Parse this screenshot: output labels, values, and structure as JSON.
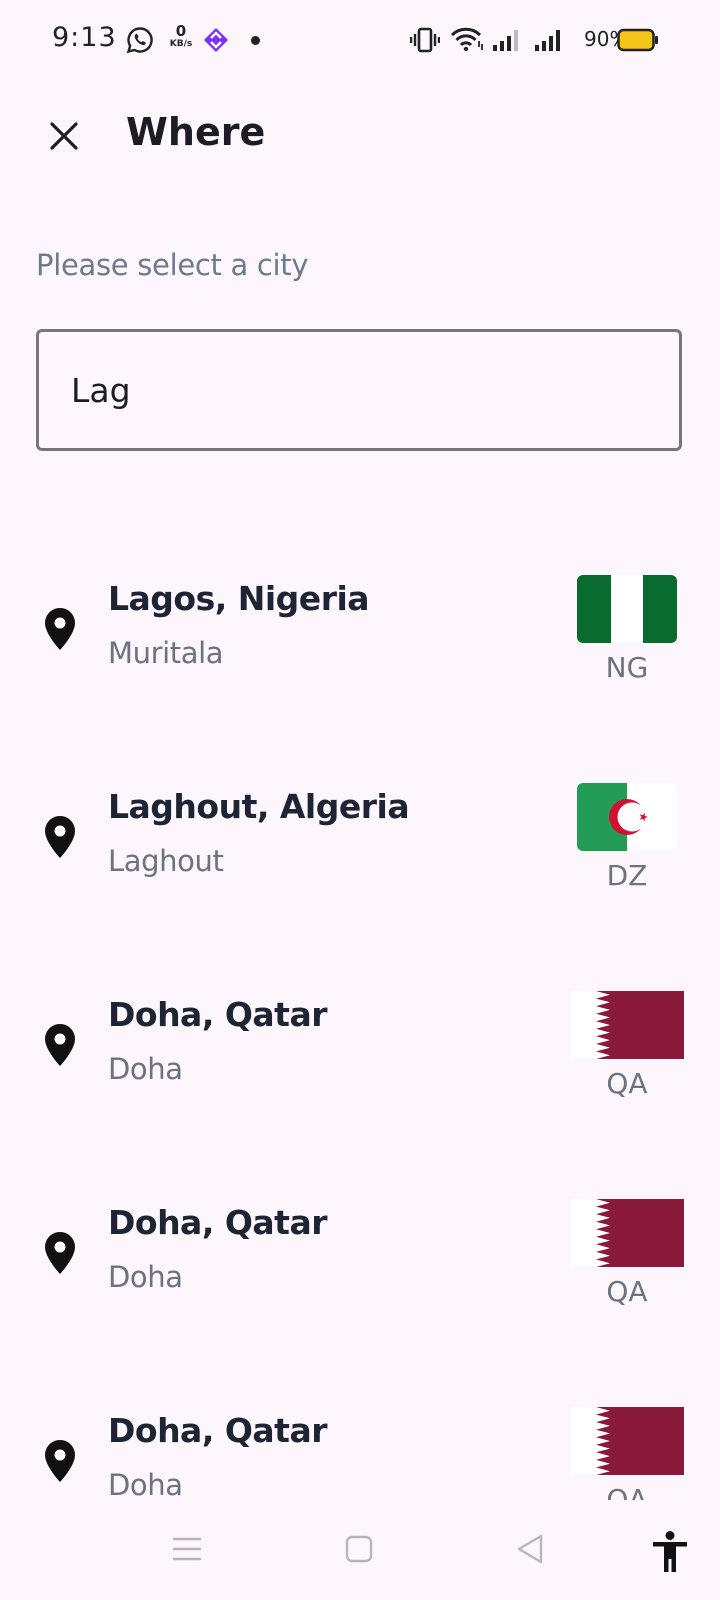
{
  "status_bar": {
    "time": "9:13",
    "net_speed_value": "0",
    "net_speed_unit": "KB/s",
    "battery": "90%",
    "icons": [
      "whatsapp-icon",
      "app-icon",
      "vibrate-icon",
      "wifi-icon",
      "signal-icon",
      "signal-icon",
      "battery-icon"
    ]
  },
  "header": {
    "title": "Where",
    "close_icon": "close-icon"
  },
  "prompt": "Please select a city",
  "search": {
    "value": "Lag",
    "placeholder": ""
  },
  "results": [
    {
      "city": "Lagos, Nigeria",
      "airport": "Muritala",
      "code": "NG",
      "flag": "nigeria-flag"
    },
    {
      "city": "Laghout, Algeria",
      "airport": "Laghout",
      "code": "DZ",
      "flag": "algeria-flag"
    },
    {
      "city": "Doha, Qatar",
      "airport": "Doha",
      "code": "QA",
      "flag": "qatar-flag"
    },
    {
      "city": "Doha, Qatar",
      "airport": "Doha",
      "code": "QA",
      "flag": "qatar-flag"
    },
    {
      "city": "Doha, Qatar",
      "airport": "Doha",
      "code": "QA",
      "flag": "qatar-flag"
    }
  ],
  "colors": {
    "background": "#fdf7fd",
    "nigeria_green": "#0a6b2e",
    "algeria_green": "#239c55",
    "algeria_red": "#d21034",
    "qatar_maroon": "#8a1a3c",
    "muted_text": "#6b7280"
  },
  "nav_bar": {
    "icons": [
      "menu-icon",
      "home-square-icon",
      "back-triangle-icon",
      "accessibility-icon"
    ]
  }
}
